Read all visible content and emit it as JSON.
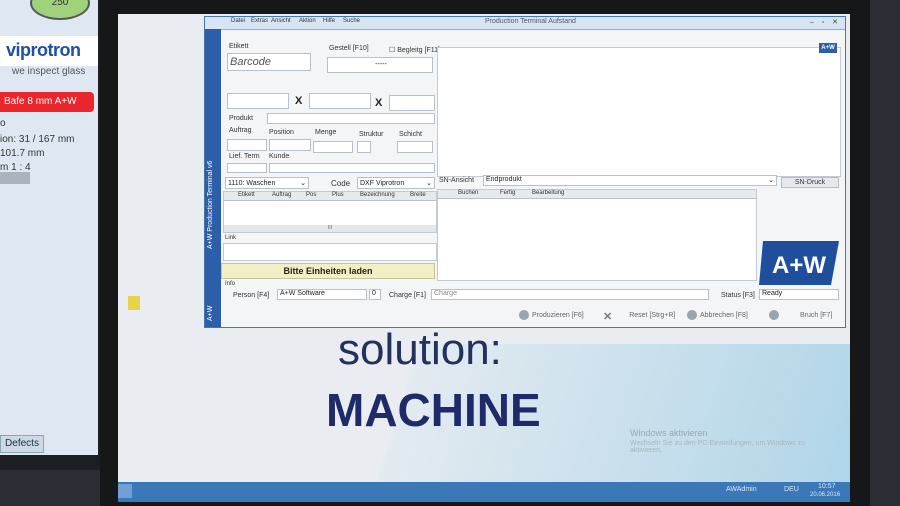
{
  "tablet": {
    "gauge": "250",
    "logo": "viprotron",
    "tagline": "we inspect glass",
    "banner": "Bafe 8 mm A+W",
    "lines": [
      "ion: 31 / 167 mm",
      "101.7 mm",
      "m 1 : 4"
    ],
    "defects_tab": "Defects",
    "top_letter": "o"
  },
  "app": {
    "title": "Production Terminal Aufstand",
    "menus": [
      "Datei",
      "Extras",
      "Ansicht",
      "Aktion",
      "Hilfe",
      "Suche"
    ],
    "side_label": "A+W Production Terminal  v6",
    "side_label2": "A+W",
    "etikett_label": "Etikett",
    "barcode": "Barcode",
    "gestell_label": "Gestell [F10]",
    "begleit_label": "Begleitg [F11]",
    "gestell_value": "-----",
    "produkt_label": "Produkt",
    "auftrag_label": "Auftrag",
    "position_label": "Position",
    "menge_label": "Menge",
    "struktur_label": "Struktur",
    "schicht_label": "Schicht",
    "liefterm_label": "Lief. Term",
    "kunde_label": "Kunde",
    "station_select": "1110: Waschen",
    "code_label": "Code",
    "code_select": "DXF Viprotron",
    "grid_headers": [
      "Etikett",
      "Auftrag",
      "Pos",
      "Plus",
      "Bezeichnung",
      "Breite"
    ],
    "scroll_value": "III",
    "link_label": "Link",
    "info_label": "Info",
    "load_units": "Bitte Einheiten laden",
    "sn_ansicht_label": "SN-Ansicht",
    "sn_select": "Endprodukt",
    "sn_druck": "SN-Druck",
    "list_headers": [
      "Buchen",
      "Fertig",
      "Bearbeitung"
    ],
    "person_label": "Person [F4]",
    "person_value": "A+W Software",
    "person_count": "0",
    "charge_label": "Charge [F1]",
    "charge_value": "Charge",
    "status_label": "Status [F3]",
    "status_value": "Ready",
    "buttons": {
      "produzieren": "Produzieren [F6]",
      "reset": "Reset [Strg+R]",
      "abbrechen": "Abbrechen [F8]",
      "bruch": "Bruch [F7]"
    },
    "aw_logo": "A+W"
  },
  "slide": {
    "line1": "solution:",
    "line2": "MACHINE",
    "activation_title": "Windows aktivieren",
    "activation_text": "Wechseln Sie zu den PC-Einstellungen, um Windows zu aktivieren."
  },
  "taskbar": {
    "user": "AWAdmin",
    "lang": "DEU",
    "time": "10:57",
    "date": "20.06.2016"
  }
}
